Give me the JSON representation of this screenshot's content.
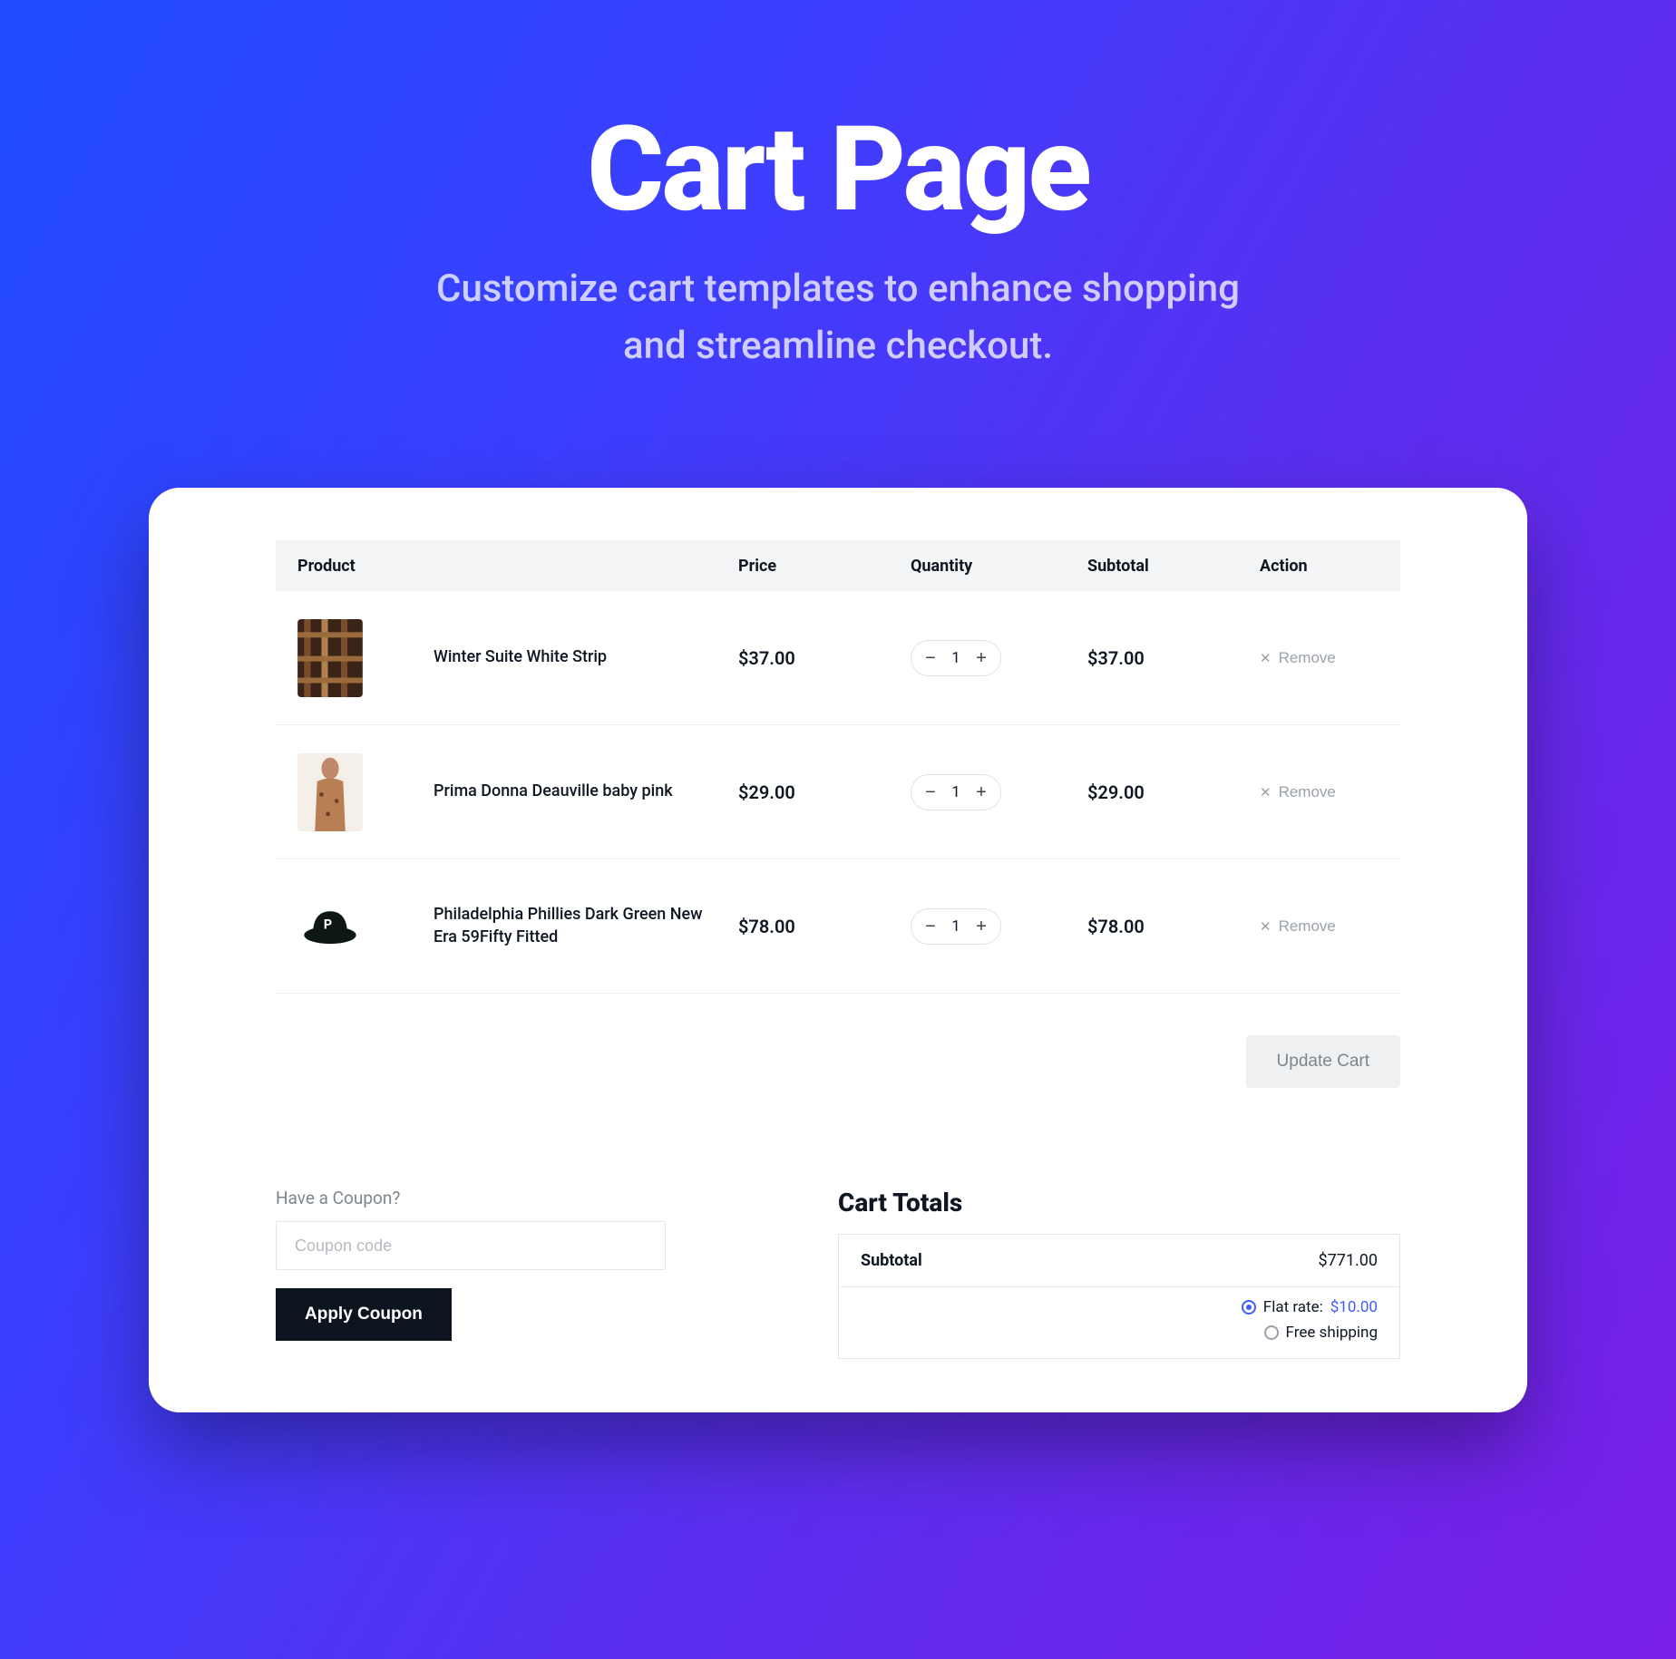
{
  "hero": {
    "title": "Cart Page",
    "subtitle": "Customize cart templates to enhance shopping\nand streamline checkout."
  },
  "table": {
    "headers": {
      "product": "Product",
      "price": "Price",
      "quantity": "Quantity",
      "subtotal": "Subtotal",
      "action": "Action"
    },
    "rows": [
      {
        "name": "Winter Suite White Strip",
        "price": "$37.00",
        "qty": "1",
        "subtotal": "$37.00",
        "thumb": "plaid"
      },
      {
        "name": "Prima Donna Deauville baby pink",
        "price": "$29.00",
        "qty": "1",
        "subtotal": "$29.00",
        "thumb": "model"
      },
      {
        "name": "Philadelphia Phillies Dark Green New Era 59Fifty Fitted",
        "price": "$78.00",
        "qty": "1",
        "subtotal": "$78.00",
        "thumb": "cap"
      }
    ],
    "remove_label": "Remove",
    "update_label": "Update Cart"
  },
  "coupon": {
    "label": "Have a Coupon?",
    "placeholder": "Coupon code",
    "button": "Apply Coupon"
  },
  "totals": {
    "title": "Cart Totals",
    "subtotal_label": "Subtotal",
    "subtotal_value": "$771.00",
    "shipping": {
      "flat_label": "Flat rate: ",
      "flat_value": "$10.00",
      "free_label": "Free shipping"
    }
  }
}
